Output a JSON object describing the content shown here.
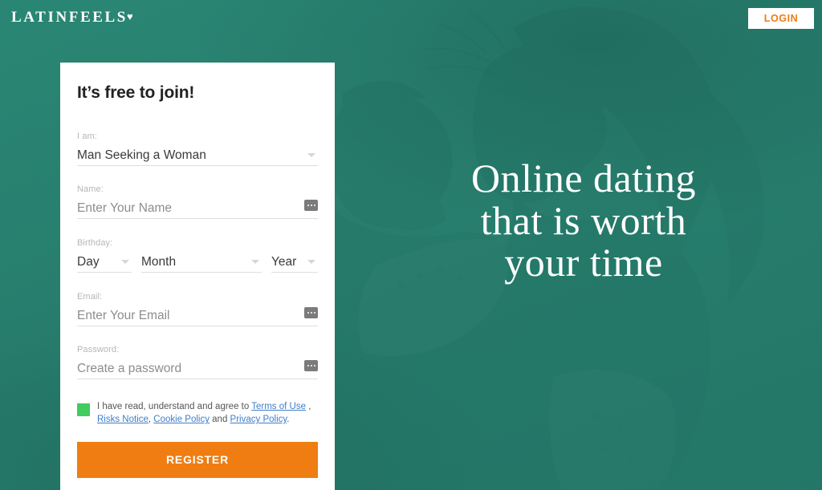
{
  "brand": {
    "logo_text": "LATINFEELS",
    "logo_heart": "♥",
    "teal": "#2a7f6e",
    "orange": "#ef7d12",
    "green": "#3fcd5e",
    "link_blue": "#3d7ec9"
  },
  "header": {
    "login_label": "LOGIN"
  },
  "hero": {
    "headline_lines": [
      "Online dating",
      "that is worth",
      "your time"
    ]
  },
  "form": {
    "title": "It’s free to join!",
    "identity": {
      "label": "I am:",
      "value": "Man Seeking a Woman"
    },
    "name": {
      "label": "Name:",
      "placeholder": "Enter Your Name",
      "value": ""
    },
    "birthday": {
      "label": "Birthday:",
      "day": "Day",
      "month": "Month",
      "year": "Year"
    },
    "email": {
      "label": "Email:",
      "placeholder": "Enter Your Email",
      "value": ""
    },
    "password": {
      "label": "Password:",
      "placeholder": "Create a password",
      "value": ""
    },
    "terms": {
      "checked": true,
      "intro": "I have read, understand and agree to ",
      "link_terms": "Terms of Use",
      "sep1": " , ",
      "link_risks": "Risks Notice",
      "sep2": ", ",
      "link_cookie": "Cookie Policy",
      "sep3": " and ",
      "link_privacy": "Privacy Policy",
      "sep4": "."
    },
    "submit_label": "REGISTER"
  }
}
